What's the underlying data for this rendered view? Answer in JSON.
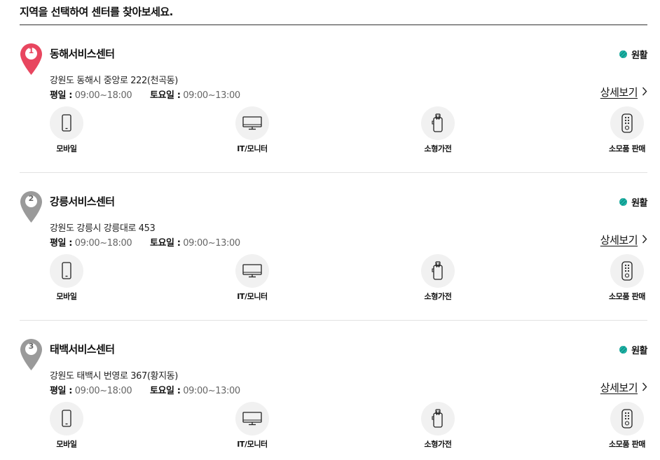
{
  "heading": "지역을 선택하여 센터를 찾아보세요.",
  "colors": {
    "pin_active": "#e8465f",
    "pin_default": "#9a9a9a",
    "status_teal": "#1fb5a8"
  },
  "centers": [
    {
      "number": "1",
      "name": "동해서비스센터",
      "status": "원활",
      "address": "강원도 동해시 중앙로 222(천곡동)",
      "weekday_label": "평일 :",
      "weekday_hours": "09:00~18:00",
      "saturday_label": "토요일 :",
      "saturday_hours": "09:00~13:00",
      "detail_label": "상세보기",
      "services": [
        {
          "icon": "mobile-phone-icon",
          "label": "모바일"
        },
        {
          "icon": "monitor-icon",
          "label": "IT/모니터"
        },
        {
          "icon": "small-appliance-icon",
          "label": "소형가전"
        },
        {
          "icon": "remote-control-icon",
          "label": "소모품 판매"
        }
      ]
    },
    {
      "number": "2",
      "name": "강릉서비스센터",
      "status": "원활",
      "address": "강원도 강릉시 강릉대로 453",
      "weekday_label": "평일 :",
      "weekday_hours": "09:00~18:00",
      "saturday_label": "토요일 :",
      "saturday_hours": "09:00~13:00",
      "detail_label": "상세보기",
      "services": [
        {
          "icon": "mobile-phone-icon",
          "label": "모바일"
        },
        {
          "icon": "monitor-icon",
          "label": "IT/모니터"
        },
        {
          "icon": "small-appliance-icon",
          "label": "소형가전"
        },
        {
          "icon": "remote-control-icon",
          "label": "소모품 판매"
        }
      ]
    },
    {
      "number": "3",
      "name": "태백서비스센터",
      "status": "원활",
      "address": "강원도 태백시 번영로 367(황지동)",
      "weekday_label": "평일 :",
      "weekday_hours": "09:00~18:00",
      "saturday_label": "토요일 :",
      "saturday_hours": "09:00~13:00",
      "detail_label": "상세보기",
      "services": [
        {
          "icon": "mobile-phone-icon",
          "label": "모바일"
        },
        {
          "icon": "monitor-icon",
          "label": "IT/모니터"
        },
        {
          "icon": "small-appliance-icon",
          "label": "소형가전"
        },
        {
          "icon": "remote-control-icon",
          "label": "소모품 판매"
        }
      ]
    }
  ]
}
